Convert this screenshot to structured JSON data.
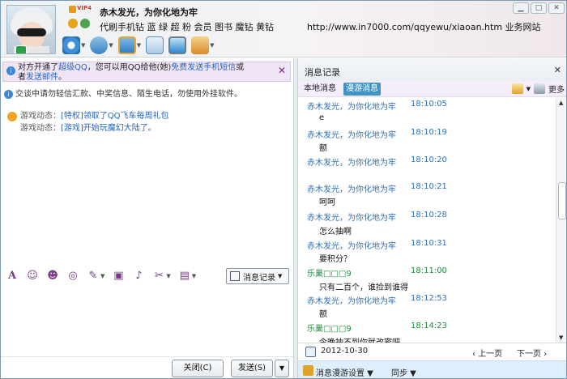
{
  "header": {
    "vip_label": "VIP4",
    "nickname": "赤木发光，为你化地为牢",
    "signature": "代刷手机钻 蓝 绿 超 粉 会员   图书  魔钻  黄钻",
    "url_text": "http://www.in7000.com/qqyewu/xiaoan.htm   业务网站",
    "window_controls": [
      "▁",
      "□",
      "✕"
    ]
  },
  "toolbar": {
    "items": [
      {
        "icon": "video-call-icon",
        "color": "#3e8fd8"
      },
      {
        "icon": "voice-call-icon",
        "color": "#5aa0d8"
      },
      {
        "icon": "send-file-icon",
        "color": "#e7a52b"
      },
      {
        "icon": "create-discussion-icon",
        "color": "#4a9ad0"
      },
      {
        "icon": "remote-assist-icon",
        "color": "#2f8bd0"
      },
      {
        "icon": "app-menu-icon",
        "color": "#d98b2e"
      }
    ]
  },
  "notice": {
    "prefix": "对方开通了",
    "super_qq": "超级QQ",
    "middle": "，您可以用QQ给他(她)",
    "free_sms": "免费发送手机短信",
    "or": "或",
    "line2_prefix": "者",
    "send_mail": "发送邮件",
    "line2_suffix": "。",
    "close": "✕"
  },
  "warning": "交谈中请勿轻信汇款、中奖信息、陌生电话，勿使用外挂软件。",
  "game_updates": [
    {
      "label": "游戏动态：",
      "text": "[特权]领取了QQ飞车每周礼包"
    },
    {
      "label": "游戏动态：",
      "text": "[游戏]开始玩魔幻大陆了。"
    }
  ],
  "format_toolbar": {
    "font": "A",
    "history_button": "消息记录"
  },
  "buttons": {
    "close": "关闭(C)",
    "send": "发送(S)",
    "send_dropdown": "▼"
  },
  "history": {
    "title": "消息记录",
    "close": "✕",
    "tab_local": "本地消息",
    "tab_roam": "漫游消息",
    "more": "更多",
    "messages": [
      {
        "name": "赤木发光，为你化地为牢",
        "time": "18:10:05",
        "text": "e",
        "green": false
      },
      {
        "name": "赤木发光，为你化地为牢",
        "time": "18:10:19",
        "text": "额",
        "green": false
      },
      {
        "name": "赤木发光，为你化地为牢",
        "time": "18:10:20",
        "text": "",
        "green": false
      },
      {
        "name": "赤木发光，为你化地为牢",
        "time": "18:10:21",
        "text": "呵呵",
        "green": false
      },
      {
        "name": "赤木发光，为你化地为牢",
        "time": "18:10:28",
        "text": "怎么抽啊",
        "green": false
      },
      {
        "name": "赤木发光，为你化地为牢",
        "time": "18:10:31",
        "text": "要积分？",
        "green": false
      },
      {
        "name": "乐巢□□□9",
        "time": "18:11:00",
        "text": "只有二百个，谁捡到谁得",
        "green": true
      },
      {
        "name": "赤木发光，为你化地为牢",
        "time": "18:12:53",
        "text": "额",
        "green": false
      },
      {
        "name": "乐巢□□□9",
        "time": "18:14:23",
        "text": "今晚抽不到你就改密吧",
        "green": true
      }
    ],
    "date": "2012-10-30",
    "prev_page": "上一页",
    "next_page": "下一页",
    "roam_settings": "消息漫游设置 ▼",
    "sync": "同步 ▼"
  }
}
